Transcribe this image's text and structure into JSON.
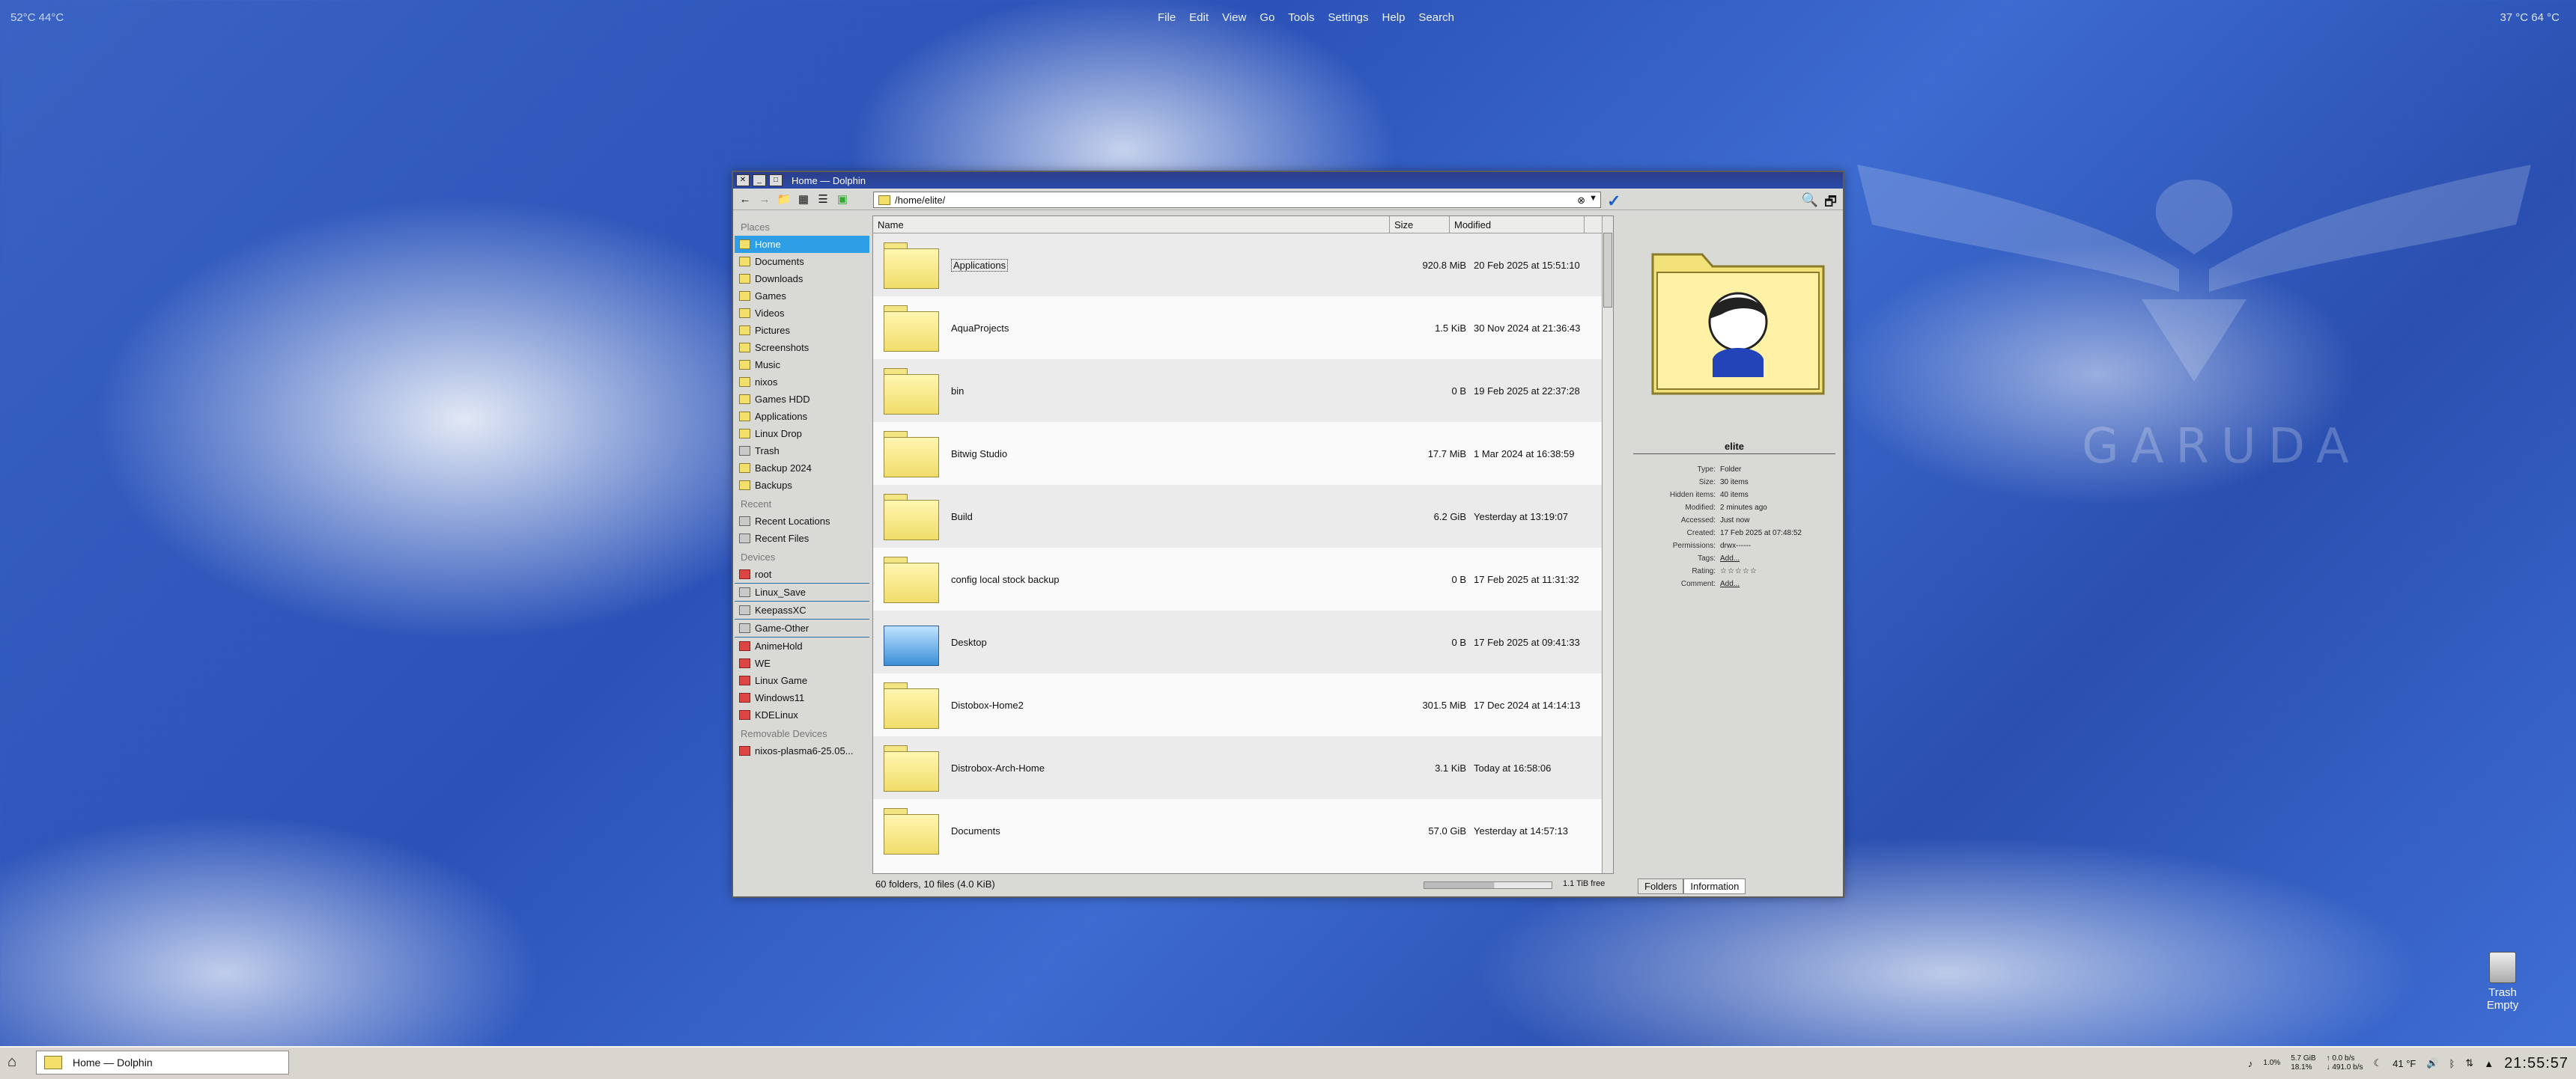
{
  "desktop": {
    "top_left_temps": "52°C  44°C",
    "menu": [
      "File",
      "Edit",
      "View",
      "Go",
      "Tools",
      "Settings",
      "Help",
      "Search"
    ],
    "top_right_temps": "37 °C   64 °C",
    "watermark": "GARUDA",
    "trash_label": "Trash",
    "trash_sub": "Empty"
  },
  "window": {
    "title": "Home — Dolphin",
    "address": "/home/elite/",
    "sidebar": {
      "places_header": "Places",
      "places": [
        "Home",
        "Documents",
        "Downloads",
        "Games",
        "Videos",
        "Pictures",
        "Screenshots",
        "Music",
        "nixos",
        "Games HDD",
        "Applications",
        "Linux Drop",
        "Trash",
        "Backup 2024",
        "Backups"
      ],
      "recent_header": "Recent",
      "recent": [
        "Recent Locations",
        "Recent Files"
      ],
      "devices_header": "Devices",
      "devices": [
        "root",
        "Linux_Save",
        "KeepassXC",
        "Game-Other",
        "AnimeHold",
        "WE",
        "Linux Game",
        "Windows11",
        "KDELinux"
      ],
      "removable_header": "Removable Devices",
      "removable": [
        "nixos-plasma6-25.05..."
      ]
    },
    "columns": {
      "name": "Name",
      "size": "Size",
      "modified": "Modified"
    },
    "files": [
      {
        "name": "Applications",
        "size": "920.8 MiB",
        "modified": "20 Feb 2025 at 15:51:10"
      },
      {
        "name": "AquaProjects",
        "size": "1.5 KiB",
        "modified": "30 Nov 2024 at 21:36:43"
      },
      {
        "name": "bin",
        "size": "0 B",
        "modified": "19 Feb 2025 at 22:37:28"
      },
      {
        "name": "Bitwig Studio",
        "size": "17.7 MiB",
        "modified": "1 Mar 2024 at 16:38:59"
      },
      {
        "name": "Build",
        "size": "6.2 GiB",
        "modified": "Yesterday at 13:19:07"
      },
      {
        "name": "config local stock backup",
        "size": "0 B",
        "modified": "17 Feb 2025 at 11:31:32"
      },
      {
        "name": "Desktop",
        "size": "0 B",
        "modified": "17 Feb 2025 at 09:41:33"
      },
      {
        "name": "Distobox-Home2",
        "size": "301.5 MiB",
        "modified": "17 Dec 2024 at 14:14:13"
      },
      {
        "name": "Distrobox-Arch-Home",
        "size": "3.1 KiB",
        "modified": "Today at 16:58:06"
      },
      {
        "name": "Documents",
        "size": "57.0 GiB",
        "modified": "Yesterday at 14:57:13"
      }
    ],
    "status": {
      "count": "60 folders, 10 files (4.0 KiB)",
      "free": "1.1 TiB free",
      "disk_used_fraction": 0.55
    },
    "tabs": [
      "Folders",
      "Information"
    ],
    "info": {
      "title": "elite",
      "rows": [
        {
          "k": "Type:",
          "v": "Folder"
        },
        {
          "k": "Size:",
          "v": "30 items"
        },
        {
          "k": "Hidden items:",
          "v": "40 items"
        },
        {
          "k": "Modified:",
          "v": "2 minutes ago"
        },
        {
          "k": "Accessed:",
          "v": "Just now"
        },
        {
          "k": "Created:",
          "v": "17 Feb 2025 at 07:48:52"
        },
        {
          "k": "Permissions:",
          "v": "drwx------"
        },
        {
          "k": "Tags:",
          "v": "Add..."
        },
        {
          "k": "Rating:",
          "v": "☆☆☆☆☆"
        },
        {
          "k": "Comment:",
          "v": "Add..."
        }
      ]
    }
  },
  "taskbar": {
    "task_title": "Home — Dolphin",
    "cpu": "1.0%",
    "mem_top": "5.7 GiB",
    "mem_bottom": "18.1%",
    "net_up": "↑  0.0 b/s",
    "net_down": "↓  491.0 b/s",
    "weather": "41 °F",
    "clock": "21:55:57"
  }
}
